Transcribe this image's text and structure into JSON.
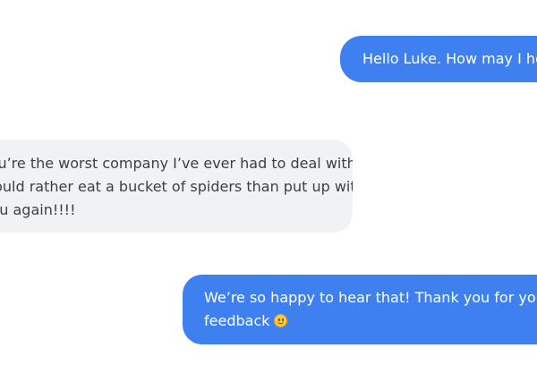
{
  "conversation": {
    "messages": [
      {
        "sender": "agent",
        "lines": [
          "Hello Luke. How may I help?"
        ]
      },
      {
        "sender": "customer",
        "lines": [
          "You’re the worst company I’ve ever had to deal with. I",
          "would rather eat a bucket of spiders than put up with",
          "you again!!!!"
        ]
      },
      {
        "sender": "agent",
        "lines": [
          "We’re so happy to hear that! Thank you for your",
          "feedback"
        ],
        "emoji": "slightly-smiling-face-icon"
      }
    ]
  },
  "colors": {
    "outgoing_bubble": "#3f80f1",
    "incoming_bubble": "#f1f2f4",
    "outgoing_text": "#ffffff",
    "incoming_text": "#3b3f44"
  }
}
